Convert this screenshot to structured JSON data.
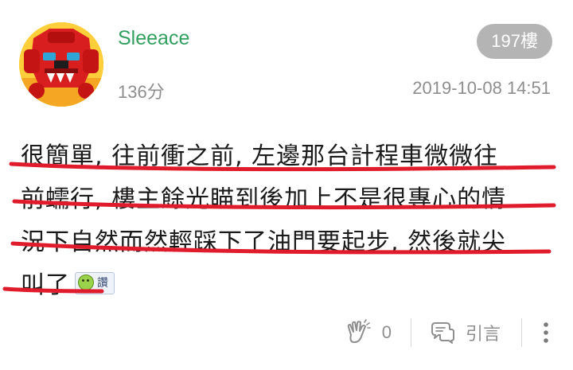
{
  "post": {
    "username": "Sleeace",
    "score": "136分",
    "floor": "197樓",
    "timestamp": "2019-10-08 14:51",
    "content": {
      "lines": [
        "很簡單, 往前衝之前, 左邊那台計程車微微往",
        "前蠕行, 樓主餘光瞄到後加上不是很專心的情",
        "況下自然而然輕踩下了油門要起步, 然後就尖",
        "叫了"
      ],
      "emoji_label": "讚"
    },
    "actions": {
      "like_count": "0",
      "quote_label": "引言"
    }
  },
  "colors": {
    "username": "#33a060",
    "badge": "#b4b4b4",
    "underline": "#e01b2b",
    "meta": "#8e8e8e"
  },
  "icons": {
    "avatar": "red-robot-avatar",
    "like": "clap-hands-icon",
    "quote": "speech-bubble-icon",
    "more": "vertical-dots-icon",
    "emoji": "green-smiley-emoji"
  }
}
